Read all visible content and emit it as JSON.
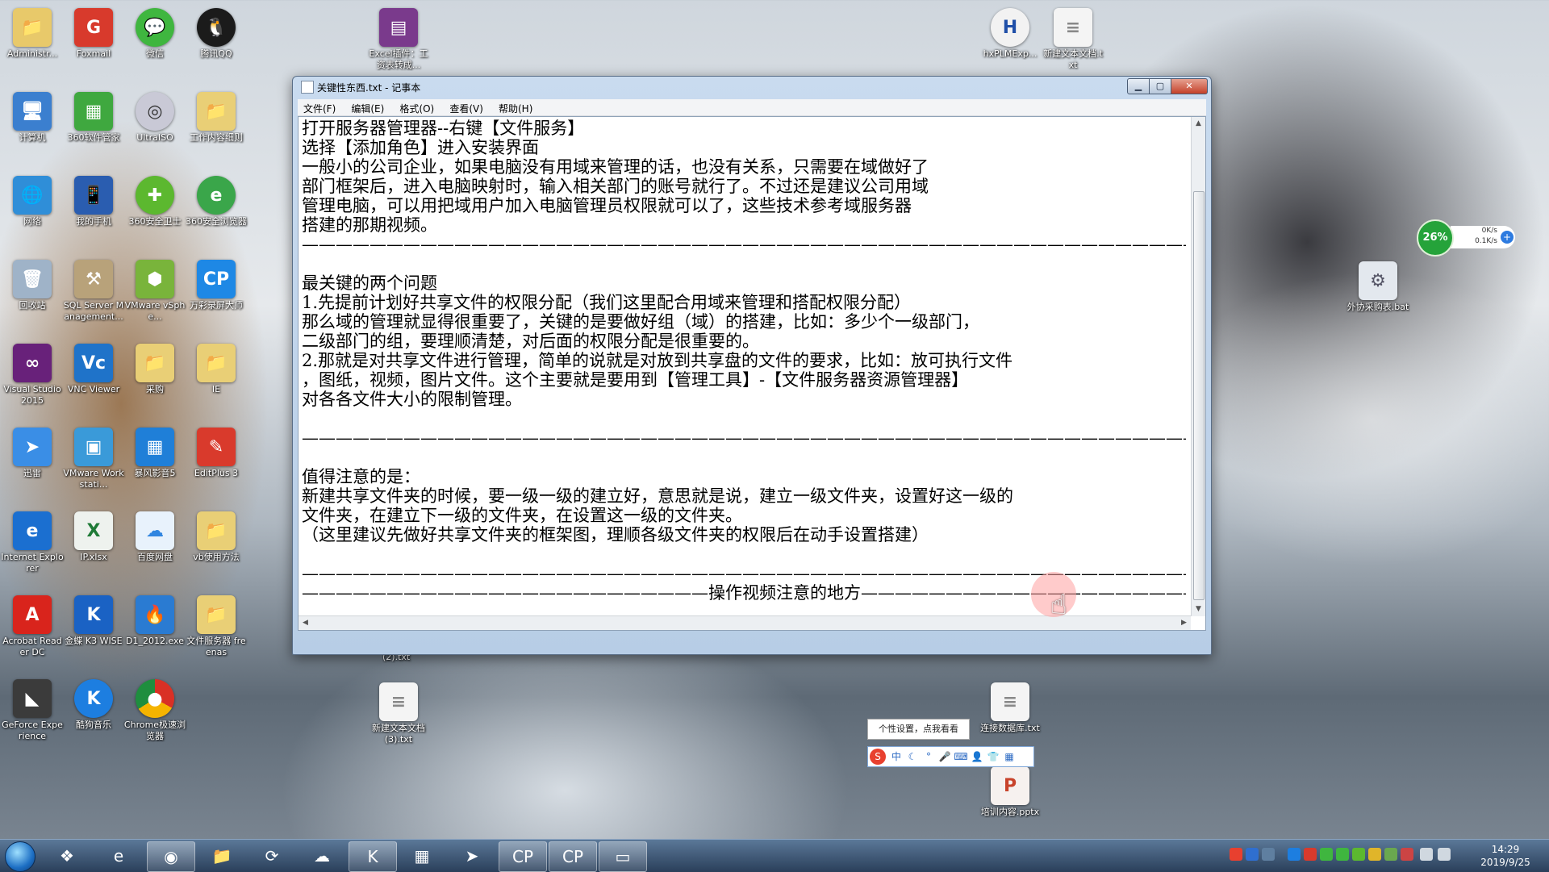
{
  "desktop_icons": {
    "col1": [
      "Administr...",
      "计算机",
      "网络",
      "回收站",
      "Visual Studio 2015",
      "迅雷",
      "Internet Explorer",
      "Acrobat Reader DC",
      "GeForce Experience"
    ],
    "col2": [
      "Foxmail",
      "360软件管家",
      "我的手机",
      "SQL Server Management...",
      "VNC Viewer",
      "VMware Workstati...",
      "IP.xlsx",
      "金蝶 K3 WISE",
      "酷狗音乐"
    ],
    "col3": [
      "微信",
      "UltraISO",
      "360安全卫士",
      "VMware vSphe...",
      "采购",
      "暴风影音5",
      "百度网盘",
      "D1_2012.exe",
      "Chrome极速浏览器"
    ],
    "col4": [
      "腾讯QQ",
      "工作内容细则",
      "360安全浏览器",
      "万彩录屏大师",
      "IE",
      "EditPlus 3",
      "vb使用方法",
      "文件服务器 freenas"
    ],
    "top_middle": "Excel插件：工资表转成...",
    "top_right_1": "hxPLMExp...",
    "top_right_2": "新建文本文档.txt",
    "right_1": "外协采购表.bat",
    "bottom_1": "新建文本文档 (3).txt",
    "bottom_2": "连接数据库.txt",
    "bottom_3": "培训内容.pptx",
    "hidden_label": "(2).txt"
  },
  "notepad": {
    "title": "关键性东西.txt - 记事本",
    "menu": [
      "文件(F)",
      "编辑(E)",
      "格式(O)",
      "查看(V)",
      "帮助(H)"
    ],
    "content": "打开服务器管理器--右键【文件服务】\n选择【添加角色】进入安装界面\n一般小的公司企业，如果电脑没有用域来管理的话，也没有关系，只需要在域做好了\n部门框架后，进入电脑映射时，输入相关部门的账号就行了。不过还是建议公司用域\n管理电脑，可以用把域用户加入电脑管理员权限就可以了，这些技术参考域服务器\n搭建的那期视频。\n——————————————————————————————————————————————————————————————\n\n最关键的两个问题\n1.先提前计划好共享文件的权限分配（我们这里配合用域来管理和搭配权限分配）\n那么域的管理就显得很重要了，关键的是要做好组（域）的搭建，比如：多少个一级部门，\n二级部门的组，要理顺清楚，对后面的权限分配是很重要的。\n2.那就是对共享文件进行管理，简单的说就是对放到共享盘的文件的要求，比如：放可执行文件\n，图纸，视频，图片文件。这个主要就是要用到【管理工具】-【文件服务器资源管理器】\n对各各文件大小的限制管理。\n\n————————————————————————————————————————————————————————————————————————————\n\n值得注意的是：\n新建共享文件夹的时候，要一级一级的建立好，意思就是说，建立一级文件夹，设置好这一级的\n文件夹，在建立下一级的文件夹，在设置这一级的文件夹。\n（这里建议先做好共享文件夹的框架图，理顺各级文件夹的权限后在动手设置搭建）\n\n——————————————————————————————————————————————————————————————————————————————————————————\n————————————————————————操作视频注意的地方————————————————————————————————————————\n\n\n现在就来看实例"
  },
  "net_monitor": {
    "percent": "26%",
    "up": "0K/s",
    "down": "0.1K/s"
  },
  "ime": {
    "tooltip": "个性设置，点我看看",
    "mode": "中"
  },
  "clock": {
    "time": "14:29",
    "date": "2019/9/25"
  },
  "colors": {
    "taskbar": "#2a3f5a",
    "title_bar": "#b7cde6",
    "close_btn": "#c4412a"
  }
}
